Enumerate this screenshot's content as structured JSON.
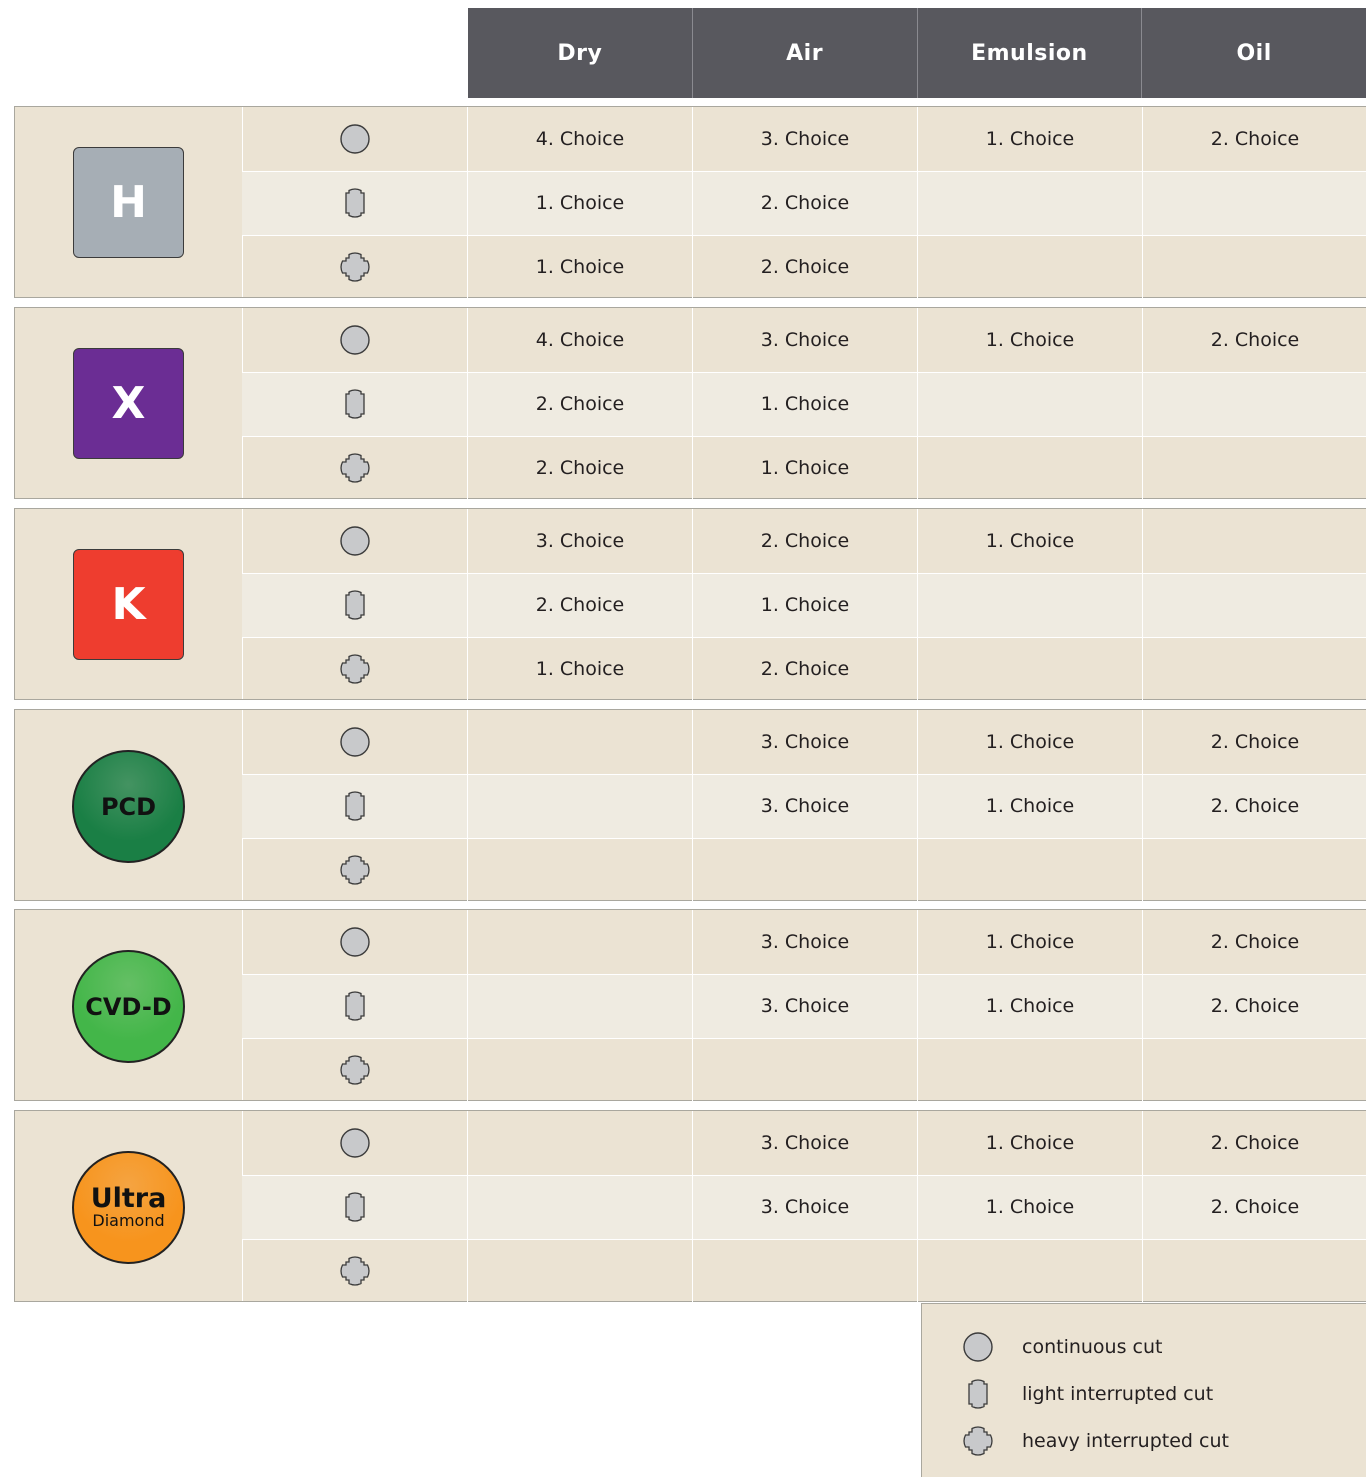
{
  "headers": [
    "Dry",
    "Air",
    "Emulsion",
    "Oil"
  ],
  "groups": [
    {
      "grade": "H",
      "shape": "square",
      "color": "#a6aeb5",
      "rows": [
        {
          "cut": "continuous",
          "values": [
            "4. Choice",
            "3. Choice",
            "1. Choice",
            "2. Choice"
          ]
        },
        {
          "cut": "light",
          "values": [
            "1. Choice",
            "2. Choice",
            "",
            ""
          ]
        },
        {
          "cut": "heavy",
          "values": [
            "1. Choice",
            "2. Choice",
            "",
            ""
          ]
        }
      ]
    },
    {
      "grade": "X",
      "shape": "square",
      "color": "#6b2d94",
      "rows": [
        {
          "cut": "continuous",
          "values": [
            "4. Choice",
            "3. Choice",
            "1. Choice",
            "2. Choice"
          ]
        },
        {
          "cut": "light",
          "values": [
            "2. Choice",
            "1. Choice",
            "",
            ""
          ]
        },
        {
          "cut": "heavy",
          "values": [
            "2. Choice",
            "1. Choice",
            "",
            ""
          ]
        }
      ]
    },
    {
      "grade": "K",
      "shape": "square",
      "color": "#ee3d2f",
      "rows": [
        {
          "cut": "continuous",
          "values": [
            "3. Choice",
            "2. Choice",
            "1. Choice",
            ""
          ]
        },
        {
          "cut": "light",
          "values": [
            "2. Choice",
            "1. Choice",
            "",
            ""
          ]
        },
        {
          "cut": "heavy",
          "values": [
            "1. Choice",
            "2. Choice",
            "",
            ""
          ]
        }
      ]
    },
    {
      "grade": "PCD",
      "shape": "round",
      "color": "#1a7f45",
      "rows": [
        {
          "cut": "continuous",
          "values": [
            "",
            "3. Choice",
            "1. Choice",
            "2. Choice"
          ]
        },
        {
          "cut": "light",
          "values": [
            "",
            "3. Choice",
            "1. Choice",
            "2. Choice"
          ]
        },
        {
          "cut": "heavy",
          "values": [
            "",
            "",
            "",
            ""
          ]
        }
      ]
    },
    {
      "grade": "CVD-D",
      "shape": "round",
      "color": "#43b649",
      "rows": [
        {
          "cut": "continuous",
          "values": [
            "",
            "3. Choice",
            "1. Choice",
            "2. Choice"
          ]
        },
        {
          "cut": "light",
          "values": [
            "",
            "3. Choice",
            "1. Choice",
            "2. Choice"
          ]
        },
        {
          "cut": "heavy",
          "values": [
            "",
            "",
            "",
            ""
          ]
        }
      ]
    },
    {
      "grade": "Ultra",
      "grade_sub": "Diamond",
      "shape": "round",
      "color": "#f7941d",
      "rows": [
        {
          "cut": "continuous",
          "values": [
            "",
            "3. Choice",
            "1. Choice",
            "2. Choice"
          ]
        },
        {
          "cut": "light",
          "values": [
            "",
            "3. Choice",
            "1. Choice",
            "2. Choice"
          ]
        },
        {
          "cut": "heavy",
          "values": [
            "",
            "",
            "",
            ""
          ]
        }
      ]
    }
  ],
  "legend": [
    {
      "cut": "continuous",
      "label": "continuous cut"
    },
    {
      "cut": "light",
      "label": "light interrupted cut"
    },
    {
      "cut": "heavy",
      "label": "heavy interrupted cut"
    }
  ]
}
